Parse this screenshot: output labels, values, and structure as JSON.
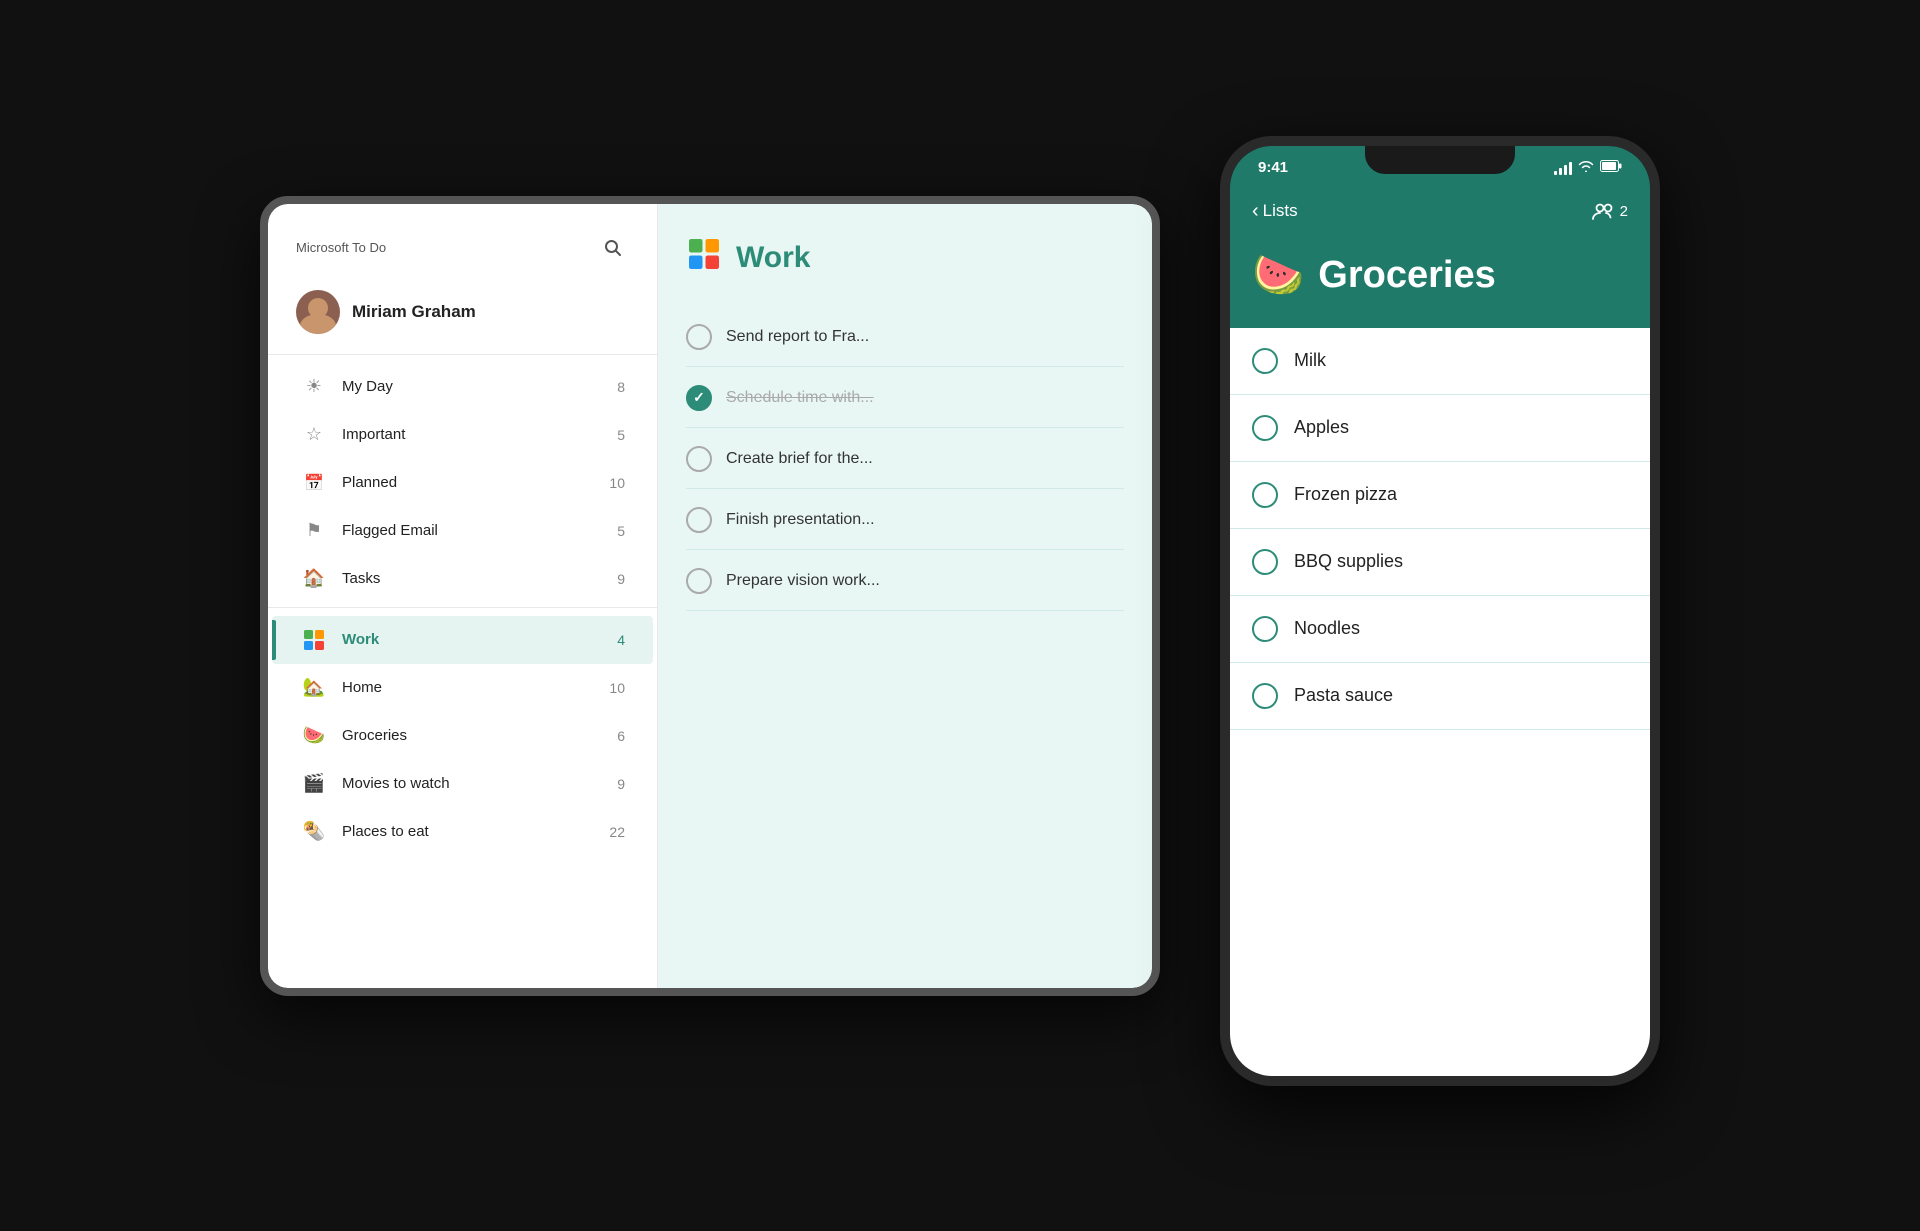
{
  "app": {
    "title": "Microsoft To Do"
  },
  "tablet": {
    "sidebar": {
      "user": {
        "name": "Miriam Graham"
      },
      "items": [
        {
          "id": "my-day",
          "label": "My Day",
          "count": "8",
          "icon": "☀",
          "active": false
        },
        {
          "id": "important",
          "label": "Important",
          "count": "5",
          "icon": "☆",
          "active": false
        },
        {
          "id": "planned",
          "label": "Planned",
          "count": "10",
          "icon": "📅",
          "active": false
        },
        {
          "id": "flagged-email",
          "label": "Flagged Email",
          "count": "5",
          "icon": "⚑",
          "active": false
        },
        {
          "id": "tasks",
          "label": "Tasks",
          "count": "9",
          "icon": "🏠",
          "active": false
        },
        {
          "id": "work",
          "label": "Work",
          "count": "4",
          "icon": "🏢",
          "active": true
        },
        {
          "id": "home",
          "label": "Home",
          "count": "10",
          "icon": "🏡",
          "active": false
        },
        {
          "id": "groceries",
          "label": "Groceries",
          "count": "6",
          "icon": "🍉",
          "active": false
        },
        {
          "id": "movies",
          "label": "Movies to watch",
          "count": "9",
          "icon": "🎬",
          "active": false
        },
        {
          "id": "places",
          "label": "Places to eat",
          "count": "22",
          "icon": "🌯",
          "active": false
        }
      ]
    },
    "work_panel": {
      "title": "Work",
      "icon": "🏢",
      "tasks": [
        {
          "id": 1,
          "text": "Send report to Fra...",
          "done": false
        },
        {
          "id": 2,
          "text": "Schedule time with...",
          "done": true
        },
        {
          "id": 3,
          "text": "Create brief for the...",
          "done": false
        },
        {
          "id": 4,
          "text": "Finish presentation...",
          "done": false
        },
        {
          "id": 5,
          "text": "Prepare vision work...",
          "done": false
        }
      ]
    }
  },
  "phone": {
    "status_bar": {
      "time": "9:41",
      "signal": "●●●●",
      "wifi": "WiFi",
      "battery": "🔋"
    },
    "nav": {
      "back_label": "Lists",
      "share_count": "2"
    },
    "grocery": {
      "title": "Groceries",
      "emoji": "🍉",
      "items": [
        {
          "id": 1,
          "label": "Milk"
        },
        {
          "id": 2,
          "label": "Apples"
        },
        {
          "id": 3,
          "label": "Frozen pizza"
        },
        {
          "id": 4,
          "label": "BBQ supplies"
        },
        {
          "id": 5,
          "label": "Noodles"
        },
        {
          "id": 6,
          "label": "Pasta sauce"
        }
      ]
    }
  }
}
